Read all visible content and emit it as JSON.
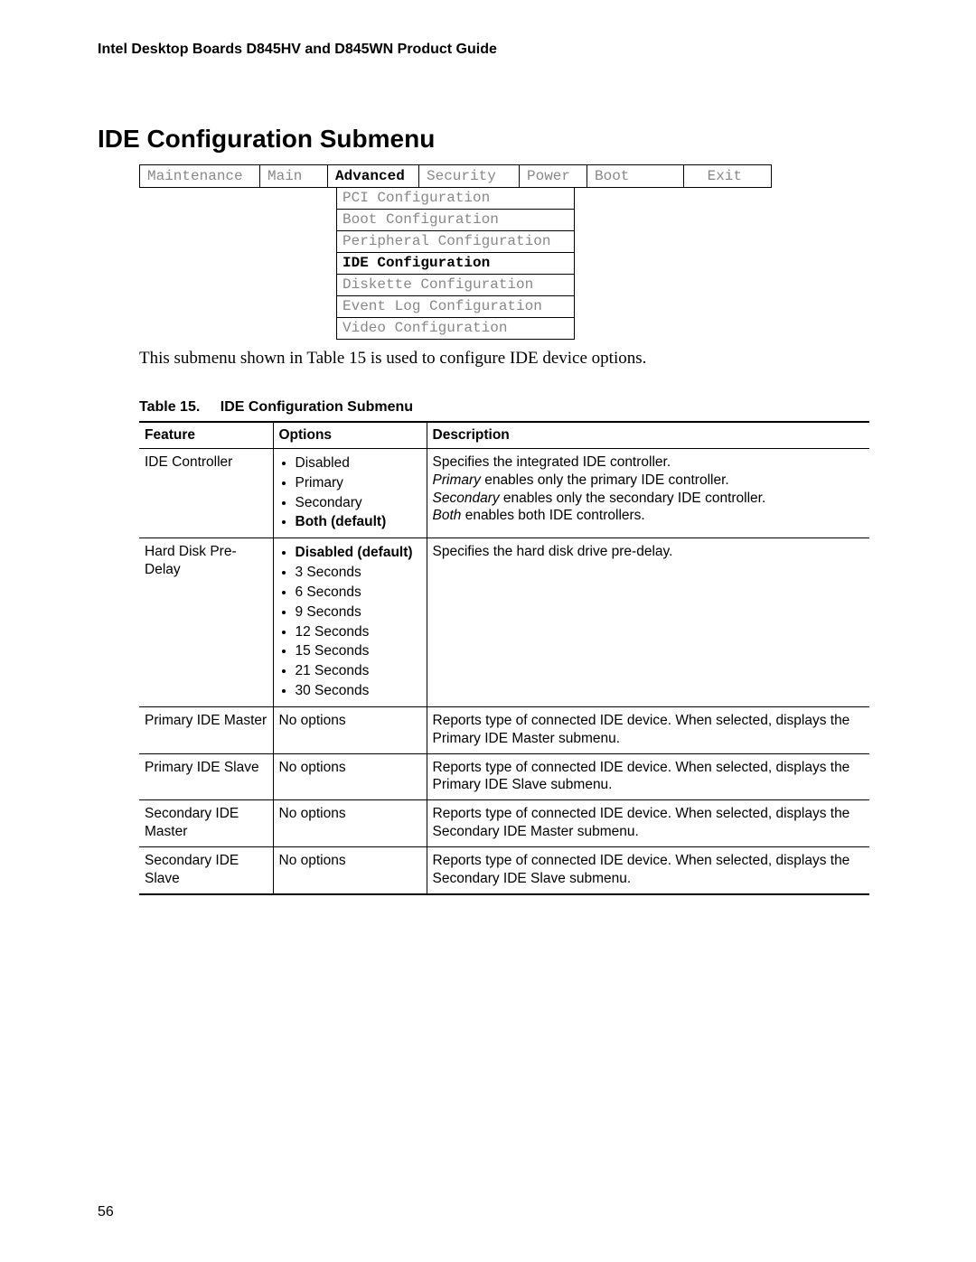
{
  "doc_header": "Intel Desktop Boards D845HV and D845WN Product Guide",
  "section_title": "IDE Configuration Submenu",
  "bios_tabs": {
    "maintenance": "Maintenance",
    "main": "Main",
    "advanced": "Advanced",
    "security": "Security",
    "power": "Power",
    "boot": "Boot",
    "exit": "Exit"
  },
  "bios_sub": {
    "pci": "PCI Configuration",
    "boot": "Boot Configuration",
    "peripheral": "Peripheral Configuration",
    "ide": "IDE Configuration",
    "diskette": "Diskette Configuration",
    "eventlog": "Event Log Configuration",
    "video": "Video Configuration"
  },
  "intro_text": "This submenu shown in Table 15 is used to configure IDE device options.",
  "table_caption": {
    "label": "Table 15.",
    "title": "IDE Configuration Submenu"
  },
  "headers": {
    "feature": "Feature",
    "options": "Options",
    "description": "Description"
  },
  "rows": {
    "ide_controller": {
      "feature": "IDE Controller",
      "opts": {
        "disabled": "Disabled",
        "primary": "Primary",
        "secondary": "Secondary",
        "both": "Both (default)"
      },
      "desc_line1": "Specifies the integrated IDE controller.",
      "desc_primary_i": "Primary",
      "desc_primary_t": " enables only the primary IDE controller.",
      "desc_secondary_i": "Secondary",
      "desc_secondary_t": " enables only the secondary IDE controller.",
      "desc_both_i": "Both",
      "desc_both_t": " enables both IDE controllers."
    },
    "predelay": {
      "feature": "Hard Disk Pre-Delay",
      "opts": {
        "disabled": "Disabled (default)",
        "s3": "3 Seconds",
        "s6": "6 Seconds",
        "s9": "9 Seconds",
        "s12": "12 Seconds",
        "s15": "15 Seconds",
        "s21": "21 Seconds",
        "s30": "30 Seconds"
      },
      "desc": "Specifies the hard disk drive pre-delay."
    },
    "pmaster": {
      "feature": "Primary IDE Master",
      "opts": "No options",
      "desc": "Reports type of connected IDE device.  When selected, displays the Primary IDE Master submenu."
    },
    "pslave": {
      "feature": "Primary IDE Slave",
      "opts": "No options",
      "desc": "Reports type of connected IDE device.  When selected, displays the Primary IDE Slave submenu."
    },
    "smaster": {
      "feature": "Secondary IDE Master",
      "opts": "No options",
      "desc": "Reports type of connected IDE device.  When selected, displays the Secondary IDE Master submenu."
    },
    "sslave": {
      "feature": "Secondary IDE Slave",
      "opts": "No options",
      "desc": "Reports type of connected IDE device.  When selected, displays the Secondary IDE Slave submenu."
    }
  },
  "page_number": "56"
}
